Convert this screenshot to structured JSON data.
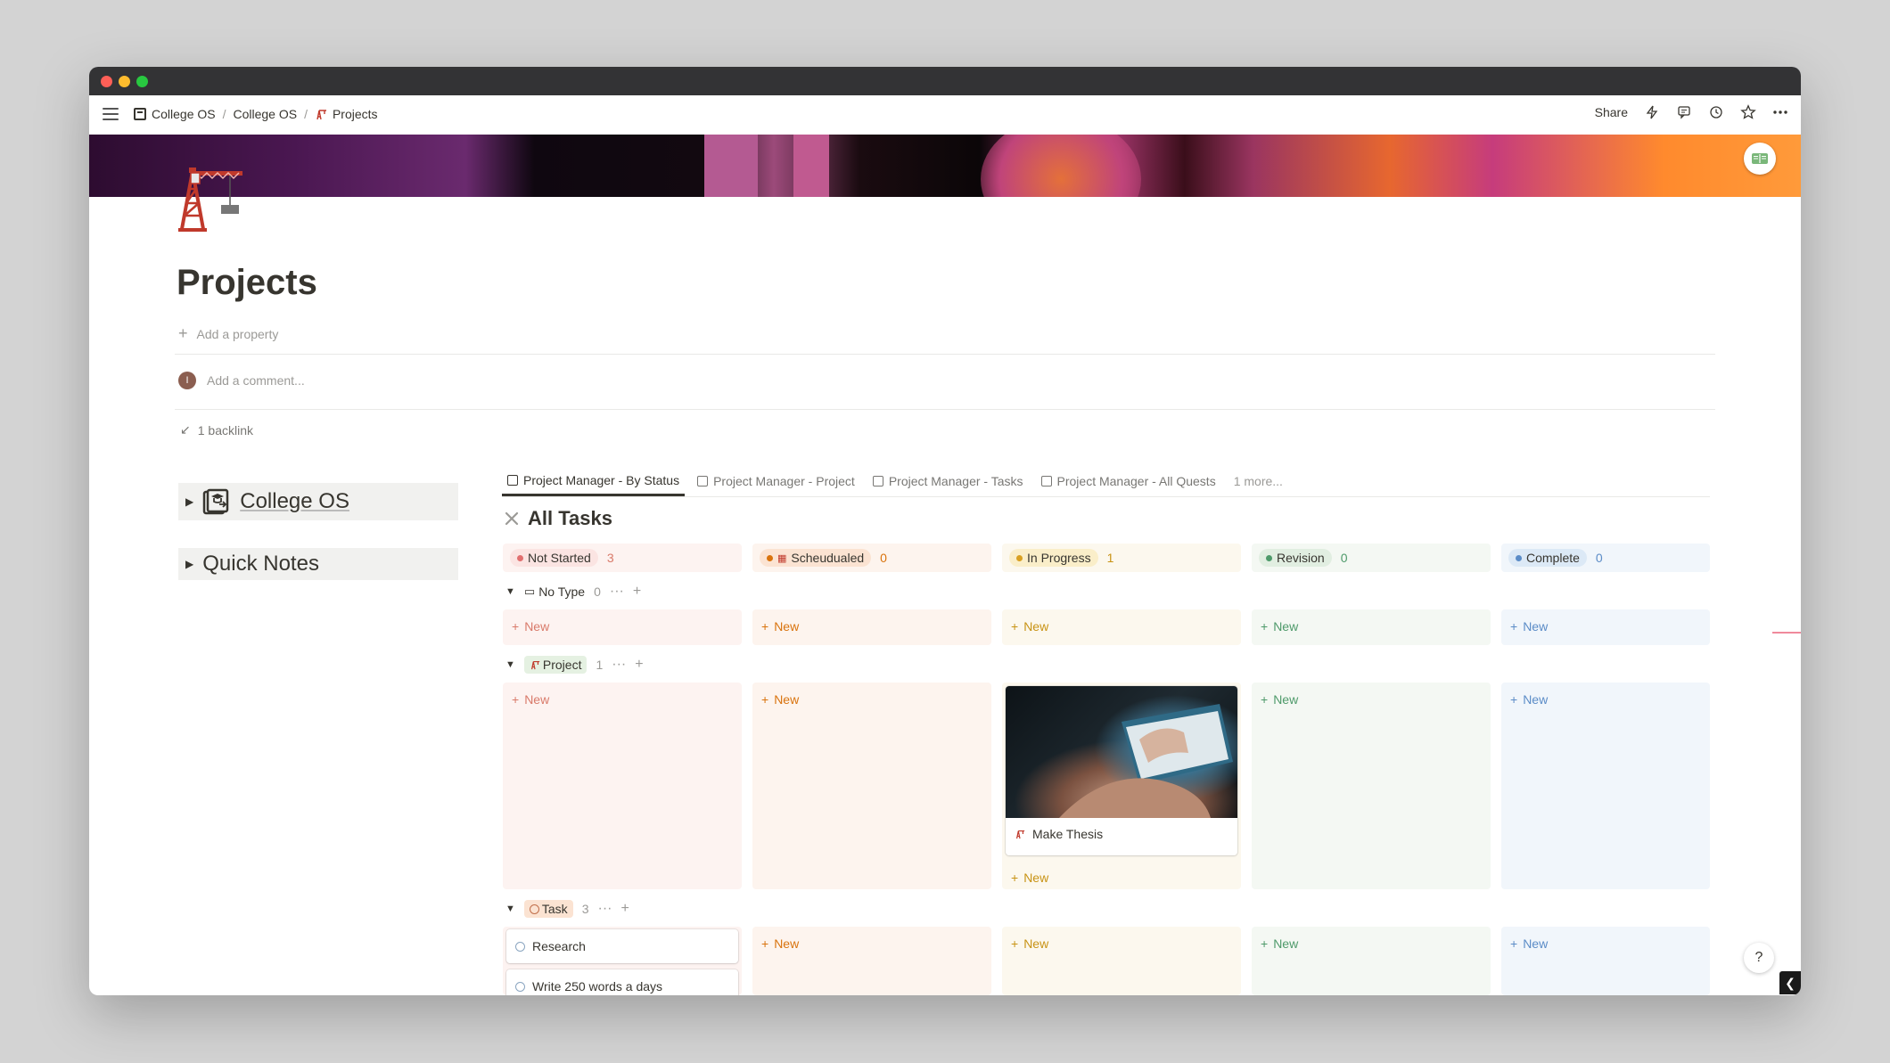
{
  "breadcrumb": {
    "items": [
      "College OS",
      "College OS",
      "Projects"
    ]
  },
  "topbar": {
    "share_label": "Share"
  },
  "icons": {
    "hamburger": "menu-icon",
    "lightning": "lightning-icon",
    "comments": "comment-icon",
    "history": "clock-icon",
    "favorite": "star-icon",
    "more": "more-icon",
    "page": "crane-icon",
    "cover_badge": "book-icon"
  },
  "page": {
    "title": "Projects",
    "add_property": "Add a property",
    "comment_placeholder": "Add a comment...",
    "avatar_initial": "I",
    "backlink": "1 backlink"
  },
  "sidebar_toggles": [
    {
      "label": "College OS"
    },
    {
      "label": "Quick Notes"
    }
  ],
  "tabs": [
    {
      "label": "Project Manager - By Status",
      "active": true
    },
    {
      "label": "Project Manager - Project"
    },
    {
      "label": "Project Manager - Tasks"
    },
    {
      "label": "Project Manager - All Quests"
    },
    {
      "label": "1 more..."
    }
  ],
  "board": {
    "title": "All Tasks",
    "new_label": "New",
    "columns": [
      {
        "status": "Not Started",
        "count": "3",
        "color": "#e16f6f"
      },
      {
        "status": "Scheudualed",
        "count": "0",
        "color": "#d9730d"
      },
      {
        "status": "In Progress",
        "count": "1",
        "color": "#d9a021"
      },
      {
        "status": "Revision",
        "count": "0",
        "color": "#4e9a6a"
      },
      {
        "status": "Complete",
        "count": "0",
        "color": "#5b8cc7"
      }
    ],
    "groups": [
      {
        "name": "No Type",
        "count": "0"
      },
      {
        "name": "Project",
        "count": "1"
      },
      {
        "name": "Task",
        "count": "3"
      }
    ],
    "cards": {
      "make_thesis": "Make Thesis",
      "research": "Research",
      "write": "Write 250 words a days"
    }
  },
  "help_label": "?"
}
